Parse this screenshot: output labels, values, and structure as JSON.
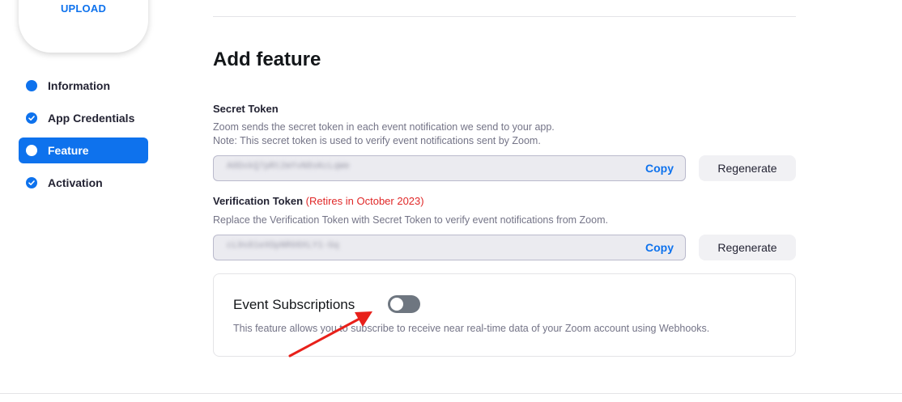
{
  "upload": {
    "label": "UPLOAD"
  },
  "sidebar": {
    "items": [
      {
        "label": "Information",
        "state": "current-dot"
      },
      {
        "label": "App Credentials",
        "state": "done"
      },
      {
        "label": "Feature",
        "state": "active"
      },
      {
        "label": "Activation",
        "state": "done"
      }
    ]
  },
  "main": {
    "title": "Add feature",
    "secret": {
      "label": "Secret Token",
      "hint_line1": "Zoom sends the secret token in each event notification we send to your app.",
      "hint_line2": "Note: This secret token is used to verify event notifications sent by Zoom.",
      "copy_label": "Copy",
      "regenerate_label": "Regenerate"
    },
    "verification": {
      "label": "Verification Token",
      "retire_note": "(Retires in October 2023)",
      "hint": "Replace the Verification Token with Secret Token to verify event notifications from Zoom.",
      "copy_label": "Copy",
      "regenerate_label": "Regenerate"
    },
    "event_subscriptions": {
      "title": "Event Subscriptions",
      "enabled": false,
      "description": "This feature allows you to subscribe to receive near real-time data of your Zoom account using Webhooks."
    }
  },
  "colors": {
    "accent": "#0e72ed",
    "warning": "#e02828",
    "toggle_off": "#6e7680",
    "annotation_arrow": "#e8201a"
  }
}
